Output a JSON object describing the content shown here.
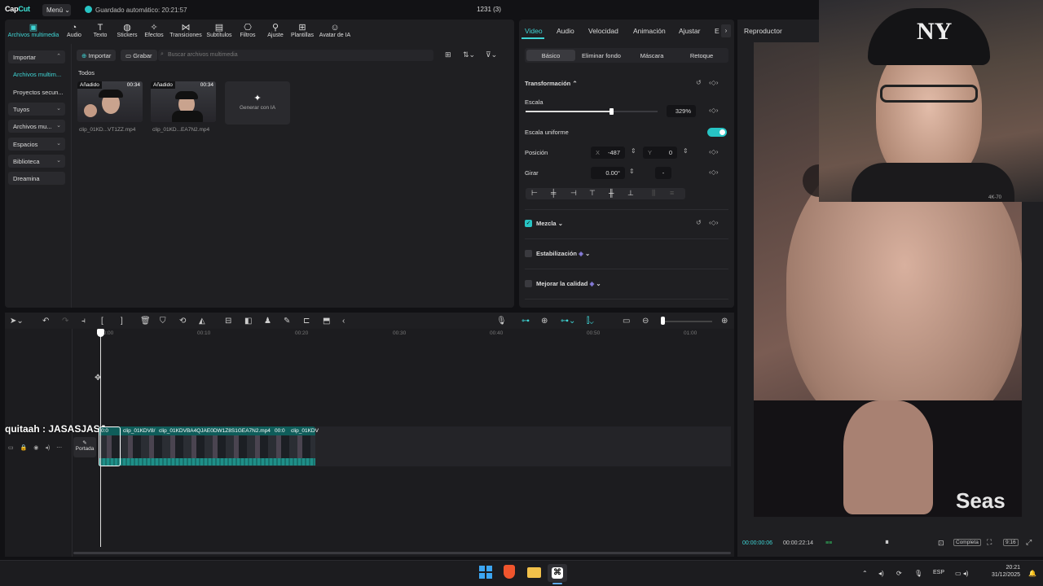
{
  "app": {
    "logo_a": "Cap",
    "logo_b": "Cut",
    "menu": "Menú",
    "autosave": "Guardado automático: 20:21:57",
    "project": "1231 (3)"
  },
  "toolbar": [
    {
      "label": "Archivos multimedia",
      "icon": "media-icon"
    },
    {
      "label": "Audio",
      "icon": "audio-icon"
    },
    {
      "label": "Texto",
      "icon": "text-icon"
    },
    {
      "label": "Stickers",
      "icon": "sticker-icon"
    },
    {
      "label": "Efectos",
      "icon": "effects-icon"
    },
    {
      "label": "Transiciones",
      "icon": "transitions-icon"
    },
    {
      "label": "Subtítulos",
      "icon": "subtitles-icon"
    },
    {
      "label": "Filtros",
      "icon": "filters-icon"
    },
    {
      "label": "Ajuste",
      "icon": "adjust-icon"
    },
    {
      "label": "Plantillas",
      "icon": "templates-icon"
    },
    {
      "label": "Avatar de IA",
      "icon": "avatar-icon"
    }
  ],
  "sidebar": [
    {
      "label": "Importar"
    },
    {
      "label": "Archivos multim..."
    },
    {
      "label": "Proyectos secun..."
    },
    {
      "label": "Tuyos"
    },
    {
      "label": "Archivos mu..."
    },
    {
      "label": "Espacios"
    },
    {
      "label": "Biblioteca"
    },
    {
      "label": "Dreamina"
    }
  ],
  "media": {
    "import": "Importar",
    "record": "Grabar",
    "search_placeholder": "Buscar archivos multimedia",
    "section": "Todos",
    "generate": "Generar con IA",
    "items": [
      {
        "tag": "Añadido",
        "duration": "00:34",
        "name": "clip_01KD...VT1ZZ.mp4"
      },
      {
        "tag": "Añadido",
        "duration": "00:34",
        "name": "clip_01KD...EA7N2.mp4"
      }
    ]
  },
  "props": {
    "tabs": [
      "Video",
      "Audio",
      "Velocidad",
      "Animación",
      "Ajustar",
      "E"
    ],
    "subtabs": [
      "Básico",
      "Eliminar fondo",
      "Máscara",
      "Retoque"
    ],
    "transform": "Transformación",
    "scale_label": "Escala",
    "scale_value": "329%",
    "scale_fraction": 0.65,
    "uniform": "Escala uniforme",
    "position": "Posición",
    "pos_x_label": "X",
    "pos_x": "-487",
    "pos_y_label": "Y",
    "pos_y": "0",
    "rotate": "Girar",
    "rotate_value": "0.00°",
    "rotate_dash": "-",
    "blend": "Mezcla",
    "stabilize": "Estabilización",
    "enhance": "Mejorar la calidad"
  },
  "player": {
    "title": "Reproductor",
    "current": "00:00:00:06",
    "total": "00:00:22:14",
    "full": "Completa",
    "ratio": "9:16",
    "watermark": "Seas",
    "cam_label": "4K-70"
  },
  "timeline": {
    "ruler": [
      "00:00",
      "00:10",
      "00:20",
      "00:30",
      "00:40",
      "00:50",
      "01:00"
    ],
    "overlay_text": "quitaah : JASASJASJ",
    "cover": "Portada",
    "clips": [
      "0:0",
      "clip_01KDV8/",
      "clip_01KDVBA4QJAE0DW1Z8S1GEA7N2.mp4",
      "00:0",
      "clip_01KDV"
    ]
  },
  "taskbar": {
    "lang": "ESP",
    "time": "20:21",
    "date": "31/12/2025"
  }
}
